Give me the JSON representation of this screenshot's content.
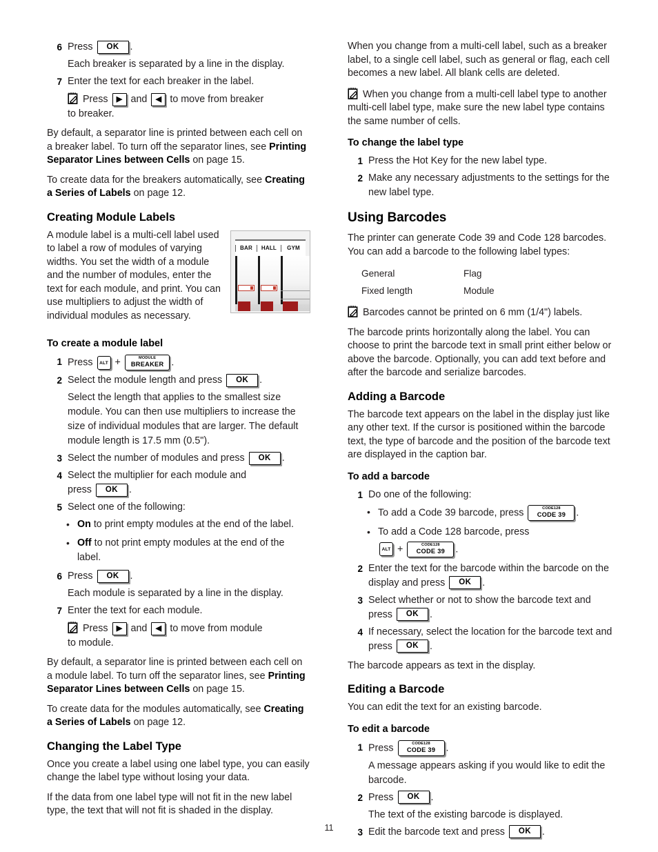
{
  "page": {
    "number": "11"
  },
  "left_column": {
    "steps_breaker": [
      {
        "num": "6",
        "text_before": "Press",
        "key": "OK",
        "text_after": ".",
        "continuation": "Each breaker is separated by a line in the display."
      },
      {
        "num": "7",
        "text_before": "Enter the text for each breaker in the label.",
        "note_press": "Press",
        "note_and": "and",
        "note_tail": "to move from breaker",
        "note_tail2": "to breaker."
      }
    ],
    "para_separator_1a": "By default, a separator line is printed between each cell on a breaker label. To turn off the separator lines, see ",
    "para_separator_1b": "Printing Separator Lines between Cells",
    "para_separator_1c": " on page 15.",
    "para_series_1a": "To create data for the breakers automatically, see ",
    "para_series_1b": "Creating a Series of Labels",
    "para_series_1c": " on page 12.",
    "heading_creating_module": "Creating Module Labels",
    "module_intro": "A module label is a multi-cell label used to label a row of modules of varying widths. You set the width of a module and the number of modules, enter the text for each module, and print. You can use multipliers to adjust the width of individual modules as necessary.",
    "photo": {
      "cells": [
        "BAR",
        "HALL",
        "GYM"
      ]
    },
    "proc_create_module": "To create a module label",
    "module_steps": [
      {
        "num": "1",
        "text_before": "Press",
        "key_alt": "ALT",
        "plus": "+",
        "key_top": "MODULE",
        "key_bottom": "BREAKER",
        "text_after": "."
      },
      {
        "num": "2",
        "text_before": "Select the module length and press",
        "key": "OK",
        "text_after": ".",
        "continuation": "Select the length that applies to the smallest size module. You can then use multipliers to increase the size of individual modules that are larger. The default module length is 17.5 mm (0.5\")."
      },
      {
        "num": "3",
        "text_before": "Select the number of modules and press",
        "key": "OK",
        "text_after": "."
      },
      {
        "num": "4",
        "text_before": "Select the multiplier for each module and",
        "text_second_line": "press",
        "key": "OK",
        "text_after": "."
      },
      {
        "num": "5",
        "text_before": "Select one of the following:",
        "bullets": [
          {
            "bold": "On",
            "rest": " to print empty modules at the end of the label."
          },
          {
            "bold": "Off",
            "rest": " to not print empty modules at the end of the label."
          }
        ]
      },
      {
        "num": "6",
        "text_before": "Press",
        "key": "OK",
        "text_after": ".",
        "continuation": "Each module is separated by a line in the display."
      },
      {
        "num": "7",
        "text_before": "Enter the text for each module.",
        "note_press": "Press",
        "note_and": "and",
        "note_tail": "to move from module",
        "note_tail2": "to module."
      }
    ],
    "para_separator_2a": "By default, a separator line is printed between each cell on a module label. To turn off the separator lines, see ",
    "para_separator_2b": "Printing Separator Lines between Cells",
    "para_separator_2c": " on page 15.",
    "para_series_2a": "To create data for the modules automatically, see ",
    "para_series_2b": "Creating a Series of Labels",
    "para_series_2c": " on page 12.",
    "heading_changing_label_type": "Changing the Label Type",
    "changing_para_1": "Once you create a label using one label type, you can easily change the label type without losing your data.",
    "changing_para_2": "If the data from one label type will not fit in the new label type, the text that will not fit is shaded in the display."
  },
  "right_column": {
    "multicell_para": "When you change from a multi-cell label, such as a breaker label, to a single cell label, such as general or flag, each cell becomes a new label. All blank cells are deleted.",
    "multicell_note": "When you change from a multi-cell label type to another multi-cell label type, make sure the new label type contains the same number of cells.",
    "proc_change_label_type": "To change the label type",
    "change_steps": [
      {
        "num": "1",
        "text": "Press the Hot Key for the new label type."
      },
      {
        "num": "2",
        "text": "Make any necessary adjustments to the settings for the new label type."
      }
    ],
    "heading_using_barcodes": "Using Barcodes",
    "barcodes_intro": "The printer can generate Code 39 and Code 128 barcodes. You can add a barcode to the following label types:",
    "label_types": [
      {
        "c1": "General",
        "c2": "Flag"
      },
      {
        "c1": "Fixed length",
        "c2": "Module"
      }
    ],
    "barcode_note": "Barcodes cannot be printed on 6 mm (1/4\") labels.",
    "barcode_para": "The barcode prints horizontally along the label. You can choose to print the barcode text in small print either below or above the barcode. Optionally, you can add text before and after the barcode and serialize barcodes.",
    "heading_adding_barcode": "Adding a Barcode",
    "adding_para": "The barcode text appears on the label in the display just like any other text. If the cursor is positioned within the barcode text, the type of barcode and the position of the barcode text are displayed in the caption bar.",
    "proc_add_barcode": "To add a barcode",
    "add_steps": [
      {
        "num": "1",
        "text_before": "Do one of the following:",
        "bullets": [
          {
            "text": "To add a Code 39 barcode, press",
            "key_top": "CODE128",
            "key_bottom": "CODE 39",
            "after": "."
          },
          {
            "text": "To add a Code 128 barcode, press",
            "key_alt": "ALT",
            "plus": "+",
            "key_top": "CODE128",
            "key_bottom": "CODE 39",
            "after": "."
          }
        ]
      },
      {
        "num": "2",
        "text_before": "Enter the text for the barcode within the barcode on the display and press",
        "key": "OK",
        "text_after": "."
      },
      {
        "num": "3",
        "text_before": "Select whether or not to show the barcode text and press",
        "key": "OK",
        "text_after": "."
      },
      {
        "num": "4",
        "text_before": "If necessary, select the location for the barcode text and press",
        "key": "OK",
        "text_after": "."
      }
    ],
    "barcode_appears": "The barcode appears as text in the display.",
    "heading_editing_barcode": "Editing a Barcode",
    "editing_para": "You can edit the text for an existing barcode.",
    "proc_edit_barcode": "To edit a barcode",
    "edit_steps": [
      {
        "num": "1",
        "text_before": "Press",
        "key_top": "CODE128",
        "key_bottom": "CODE 39",
        "text_after": ".",
        "continuation": "A message appears asking if you would like to edit the barcode."
      },
      {
        "num": "2",
        "text_before": "Press",
        "key": "OK",
        "text_after": ".",
        "continuation": "The text of the existing barcode is displayed."
      },
      {
        "num": "3",
        "text_before": "Edit the barcode text and press",
        "key": "OK",
        "text_after": "."
      }
    ]
  }
}
